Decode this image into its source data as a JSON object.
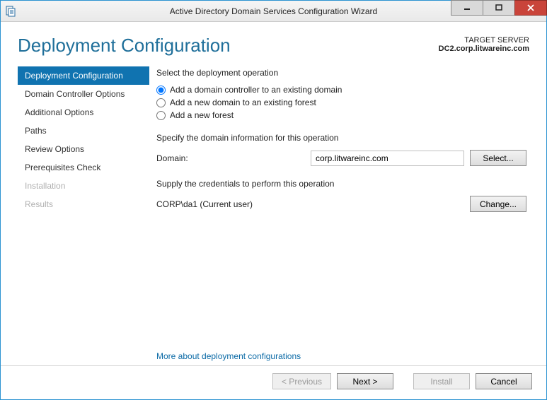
{
  "window": {
    "title": "Active Directory Domain Services Configuration Wizard"
  },
  "header": {
    "page_title": "Deployment Configuration",
    "target_label": "TARGET SERVER",
    "target_server": "DC2.corp.litwareinc.com"
  },
  "nav": {
    "steps": [
      {
        "label": "Deployment Configuration",
        "state": "selected"
      },
      {
        "label": "Domain Controller Options",
        "state": "enabled"
      },
      {
        "label": "Additional Options",
        "state": "enabled"
      },
      {
        "label": "Paths",
        "state": "enabled"
      },
      {
        "label": "Review Options",
        "state": "enabled"
      },
      {
        "label": "Prerequisites Check",
        "state": "enabled"
      },
      {
        "label": "Installation",
        "state": "disabled"
      },
      {
        "label": "Results",
        "state": "disabled"
      }
    ]
  },
  "content": {
    "operation_label": "Select the deployment operation",
    "operations": [
      {
        "label": "Add a domain controller to an existing domain",
        "checked": true
      },
      {
        "label": "Add a new domain to an existing forest",
        "checked": false
      },
      {
        "label": "Add a new forest",
        "checked": false
      }
    ],
    "domain_info_label": "Specify the domain information for this operation",
    "domain_label": "Domain:",
    "domain_value": "corp.litwareinc.com",
    "select_button": "Select...",
    "creds_label": "Supply the credentials to perform this operation",
    "creds_value": "CORP\\da1 (Current user)",
    "change_button": "Change...",
    "more_link": "More about deployment configurations"
  },
  "footer": {
    "previous": "< Previous",
    "next": "Next >",
    "install": "Install",
    "cancel": "Cancel"
  }
}
